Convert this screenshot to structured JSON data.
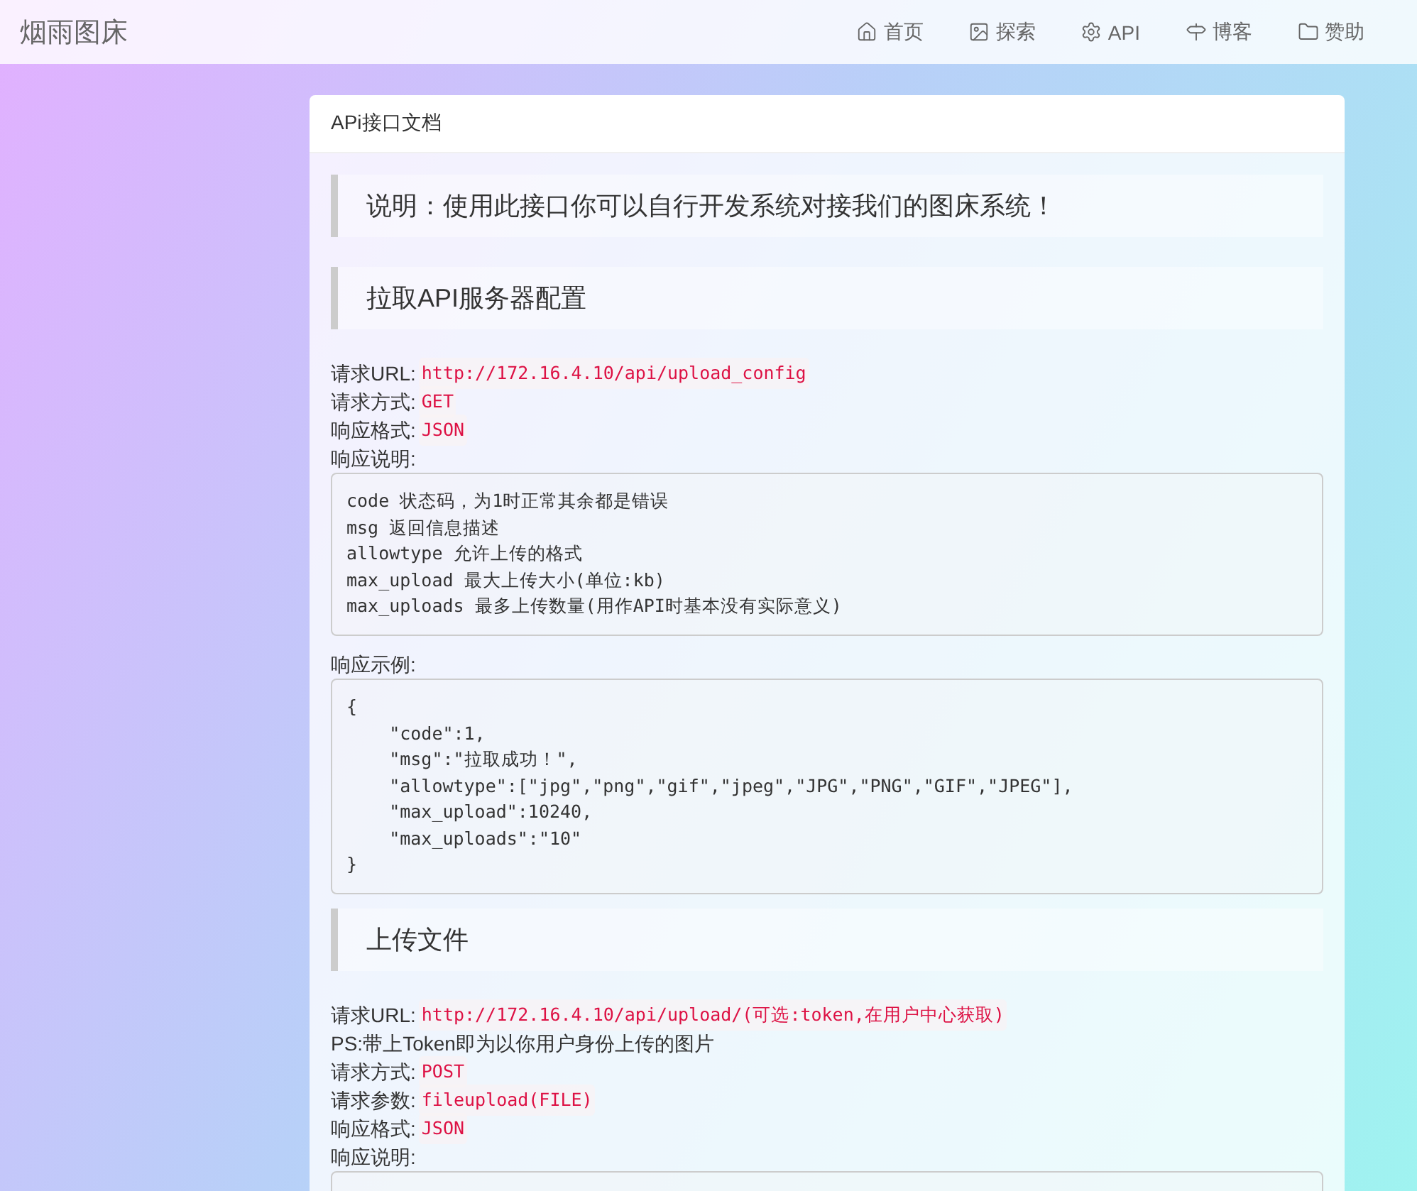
{
  "navbar": {
    "brand": "烟雨图床",
    "items": [
      {
        "label": "首页"
      },
      {
        "label": "探索"
      },
      {
        "label": "API"
      },
      {
        "label": "博客"
      },
      {
        "label": "赞助"
      }
    ]
  },
  "card": {
    "title": "APi接口文档",
    "blocks": [
      {
        "kind": "note",
        "text": "说明：使用此接口你可以自行开发系统对接我们的图床系统！"
      },
      {
        "kind": "heading",
        "text": "拉取API服务器配置"
      },
      {
        "kind": "field",
        "label": "请求URL:",
        "value": "http://172.16.4.10/api/upload_config"
      },
      {
        "kind": "field",
        "label": "请求方式:",
        "value": "GET"
      },
      {
        "kind": "field",
        "label": "响应格式:",
        "value": "JSON"
      },
      {
        "kind": "text",
        "text": "响应说明:"
      },
      {
        "kind": "code",
        "lines": [
          "code 状态码，为1时正常其余都是错误",
          "msg 返回信息描述",
          "allowtype 允许上传的格式",
          "max_upload 最大上传大小(单位:kb)",
          "max_uploads 最多上传数量(用作API时基本没有实际意义)"
        ]
      },
      {
        "kind": "text",
        "text": "响应示例:"
      },
      {
        "kind": "code",
        "lines": [
          "{",
          "    \"code\":1,",
          "    \"msg\":\"拉取成功！\",",
          "    \"allowtype\":[\"jpg\",\"png\",\"gif\",\"jpeg\",\"JPG\",\"PNG\",\"GIF\",\"JPEG\"],",
          "    \"max_upload\":10240,",
          "    \"max_uploads\":\"10\"",
          "}"
        ]
      },
      {
        "kind": "heading",
        "text": "上传文件"
      },
      {
        "kind": "field",
        "label": "请求URL:",
        "value": "http://172.16.4.10/api/upload/(可选:token,在用户中心获取)"
      },
      {
        "kind": "text",
        "text": "PS:带上Token即为以你用户身份上传的图片"
      },
      {
        "kind": "field",
        "label": "请求方式:",
        "value": "POST"
      },
      {
        "kind": "field",
        "label": "请求参数:",
        "value": "fileupload(FILE)"
      },
      {
        "kind": "field",
        "label": "响应格式:",
        "value": "JSON"
      },
      {
        "kind": "text",
        "text": "响应说明:"
      },
      {
        "kind": "code"
      }
    ]
  }
}
